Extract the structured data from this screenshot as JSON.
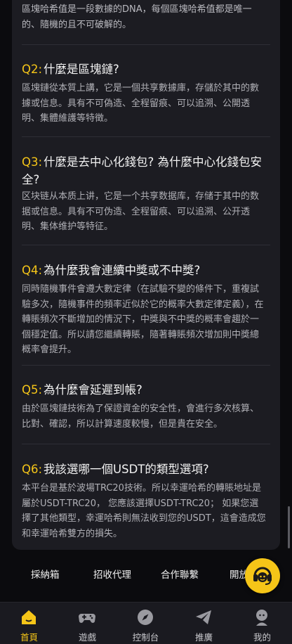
{
  "intro_text": "區塊哈希值是一段數據的DNA，每個區塊哈希值都是唯一的、隨機的且不可破解的。",
  "faqs": [
    {
      "num": "Q2:",
      "question": "什麼是區塊鏈?",
      "answer": "區塊鏈從本質上講，它是一個共享數據庫，存儲於其中的數據或信息。具有不可偽造、全程留痕、可以追溯、公開透明、集體維護等特徵。"
    },
    {
      "num": "Q3:",
      "question": "什麼是去中心化錢包? 為什麼中心化錢包安全?",
      "answer": "区块链从本质上讲，它是一个共享数据库，存储于其中的数据或信息。具有不可伪造、全程留痕、可以追溯、公开透明、集体维护等特征。"
    },
    {
      "num": "Q4:",
      "question": "為什麼我會連續中獎或不中獎?",
      "answer": "同時隨機事件會遵大數定律（在試驗不變的條件下，重複試驗多次，隨機事件的頻率近似於它的概率大數定律定義），在轉賬頻次不斷增加的情況下，中獎與不中獎的概率會趨於一個穩定值。所以請您繼續轉賬，隨著轉賬頻次增加則中獎總概率會提升。"
    },
    {
      "num": "Q5:",
      "question": "為什麼會延遲到帳?",
      "answer": "由於區塊鏈技術為了保證資金的安全性，會進行多次核算、比對、確認，所以計算速度較慢，但是貴在安全。"
    },
    {
      "num": "Q6:",
      "question": "我該選哪一個USDT的類型選項?",
      "answer": "本平台是基於波場TRC20技術。所以幸運哈希的轉賬地址是屬於USDT-TRC20， 您應該選擇USDT-TRC20； 如果您選擇了其他類型，幸運哈希則無法收到您的USDT，這會造成您和幸運哈希雙方的損失。"
    }
  ],
  "footer_links": [
    "採納箱",
    "招收代理",
    "合作聯繫",
    "開放"
  ],
  "tabs": [
    {
      "label": "首頁",
      "icon": "home-icon",
      "active": true
    },
    {
      "label": "遊戲",
      "icon": "gamepad-icon",
      "active": false
    },
    {
      "label": "控制台",
      "icon": "compass-icon",
      "active": false
    },
    {
      "label": "推廣",
      "icon": "send-icon",
      "active": false
    },
    {
      "label": "我的",
      "icon": "user-icon",
      "active": false
    }
  ],
  "colors": {
    "accent": "#f5c518",
    "background": "#0b0b0e",
    "card": "#1c1c22"
  }
}
